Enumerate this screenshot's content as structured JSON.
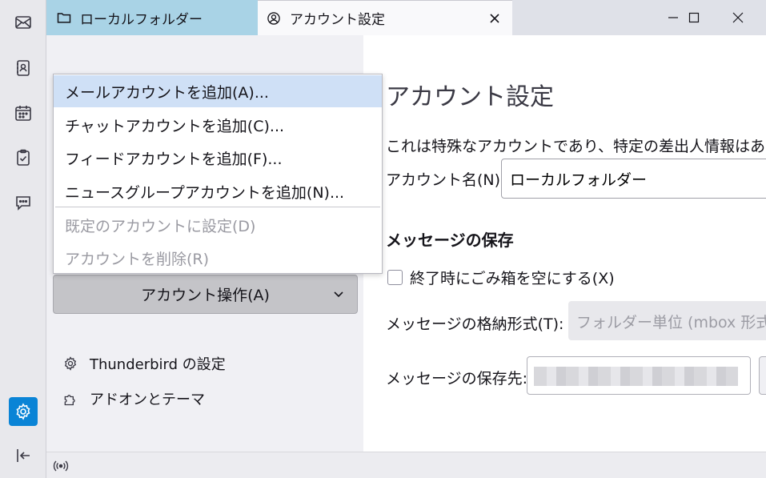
{
  "spaces": [
    {
      "name": "mail",
      "icon": "mail-icon"
    },
    {
      "name": "address-book",
      "icon": "address-book-icon"
    },
    {
      "name": "calendar",
      "icon": "calendar-icon"
    },
    {
      "name": "tasks",
      "icon": "tasks-icon"
    },
    {
      "name": "chat",
      "icon": "chat-icon"
    },
    {
      "name": "settings",
      "icon": "gear-icon",
      "active": true
    },
    {
      "name": "collapse",
      "icon": "collapse-icon"
    }
  ],
  "tabs": [
    {
      "label": "ローカルフォルダー",
      "icon": "folder-icon"
    },
    {
      "label": "アカウント設定",
      "icon": "account-settings-icon",
      "active": true
    }
  ],
  "left": {
    "action_button": "アカウント操作(A)",
    "settings_link": "Thunderbird の設定",
    "addons_link": "アドオンとテーマ"
  },
  "menu": {
    "items": [
      {
        "label": "メールアカウントを追加(A)...",
        "highlighted": true
      },
      {
        "label": "チャットアカウントを追加(C)..."
      },
      {
        "label": "フィードアカウントを追加(F)..."
      },
      {
        "label": "ニュースグループアカウントを追加(N)..."
      },
      {
        "label": "既定のアカウントに設定(D)",
        "disabled": true
      },
      {
        "label": "アカウントを削除(R)",
        "disabled": true
      }
    ]
  },
  "main": {
    "title": "アカウント設定",
    "description": "これは特殊なアカウントであり、特定の差出人情報はあ",
    "account_name_label": "アカウント名(N):",
    "account_name_value": "ローカルフォルダー",
    "storage_heading": "メッセージの保存",
    "empty_trash_label": "終了時にごみ箱を空にする(X)",
    "empty_trash_checked": false,
    "format_label": "メッセージの格納形式(T):",
    "format_value": "フォルダー単位 (mbox 形式",
    "store_label": "メッセージの保存先:"
  },
  "colors": {
    "accent": "#0a84d6",
    "tab_inactive": "#a9d3e6",
    "menu_highlight": "#cfe0f6"
  }
}
